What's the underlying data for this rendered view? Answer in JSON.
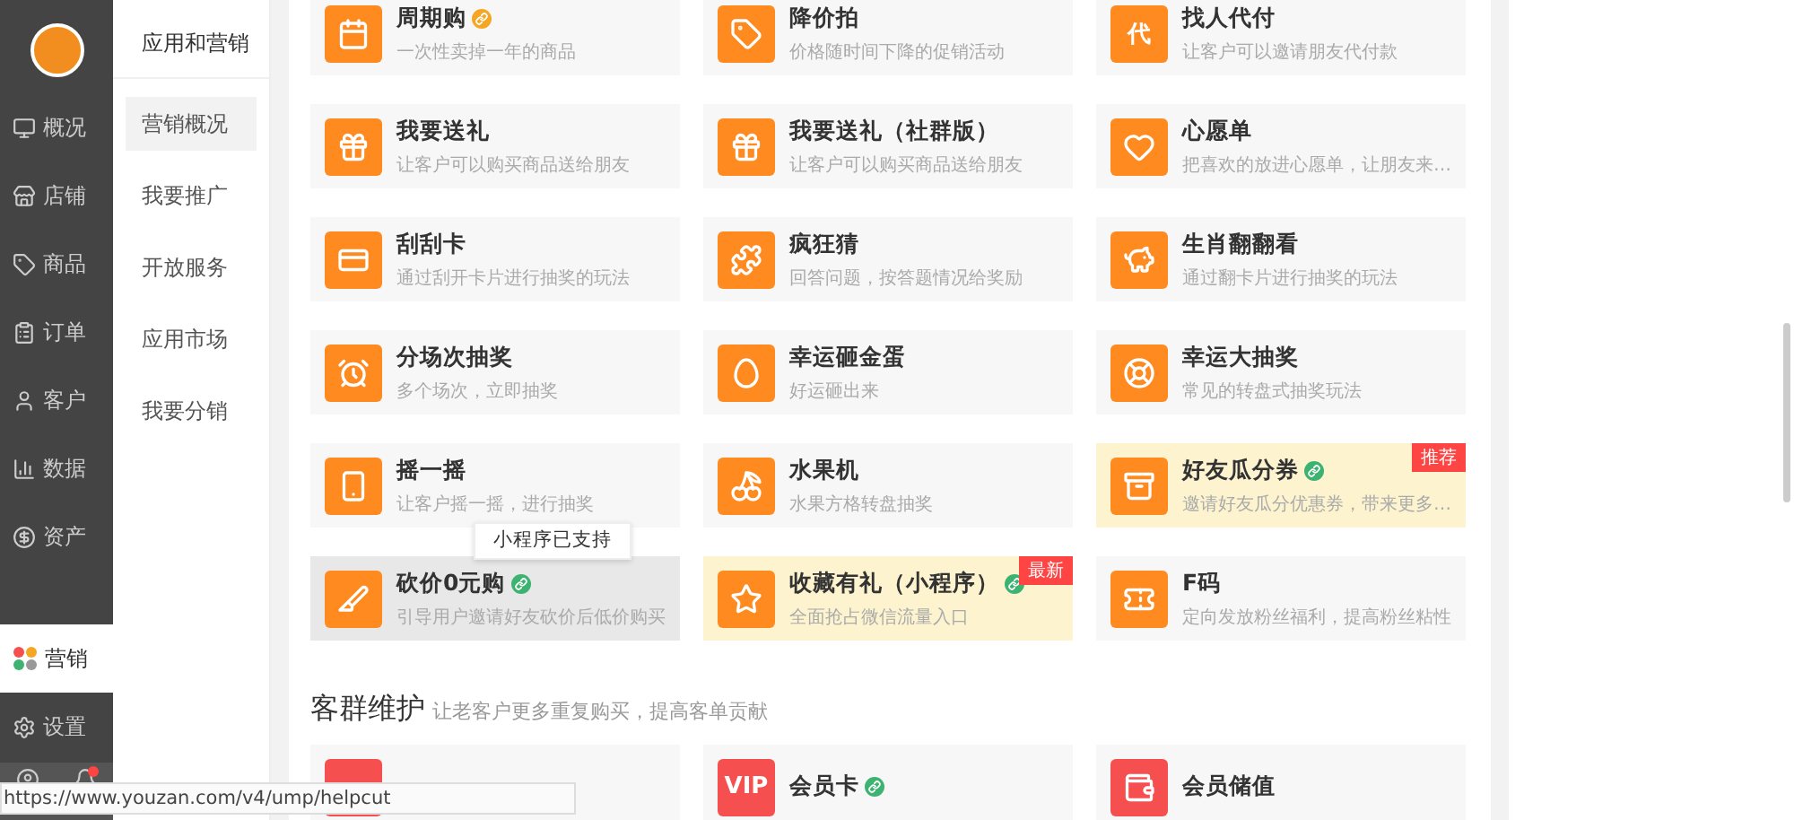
{
  "sidebar": {
    "items": [
      {
        "label": "概况",
        "kind": "monitor",
        "selected": false
      },
      {
        "label": "店铺",
        "kind": "store",
        "selected": false
      },
      {
        "label": "商品",
        "kind": "tag",
        "selected": false
      },
      {
        "label": "订单",
        "kind": "order",
        "selected": false
      },
      {
        "label": "客户",
        "kind": "user",
        "selected": false
      },
      {
        "label": "数据",
        "kind": "chart",
        "selected": false
      },
      {
        "label": "资产",
        "kind": "coin",
        "selected": false
      },
      {
        "label": "营销",
        "kind": "grid",
        "selected": true
      },
      {
        "label": "设置",
        "kind": "settings",
        "selected": false
      }
    ],
    "notification": true
  },
  "subnav": {
    "title": "应用和营销",
    "items": [
      {
        "label": "营销概况",
        "selected": true
      },
      {
        "label": "我要推广",
        "selected": false
      },
      {
        "label": "开放服务",
        "selected": false
      },
      {
        "label": "应用市场",
        "selected": false
      },
      {
        "label": "我要分销",
        "selected": false
      }
    ]
  },
  "sections": [
    {
      "cards": [
        {
          "title": "周期购",
          "desc": "一次性卖掉一年的商品",
          "kind": "calendar",
          "color": "#ff8a1f",
          "badge": {
            "color": "#f5a623"
          },
          "featured": false,
          "hovered": false
        },
        {
          "title": "降价拍",
          "desc": "价格随时间下降的促销活动",
          "kind": "tag",
          "color": "#ff8a1f",
          "featured": false,
          "hovered": false
        },
        {
          "title": "找人代付",
          "desc": "让客户可以邀请朋友代付款",
          "kind": "glyph",
          "icon_text": "代",
          "color": "#ff8a1f",
          "featured": false,
          "hovered": false
        },
        {
          "title": "我要送礼",
          "desc": "让客户可以购买商品送给朋友",
          "kind": "gift",
          "color": "#ff8a1f",
          "featured": false,
          "hovered": false
        },
        {
          "title": "我要送礼（社群版）",
          "desc": "让客户可以购买商品送给朋友",
          "kind": "gift",
          "color": "#ff8a1f",
          "featured": false,
          "hovered": false
        },
        {
          "title": "心愿单",
          "desc": "把喜欢的放进心愿单，让朋友来…",
          "kind": "heart",
          "color": "#ff8a1f",
          "featured": false,
          "hovered": false
        },
        {
          "title": "刮刮卡",
          "desc": "通过刮开卡片进行抽奖的玩法",
          "kind": "card",
          "color": "#ff8a1f",
          "featured": false,
          "hovered": false
        },
        {
          "title": "疯狂猜",
          "desc": "回答问题，按答题情况给奖励",
          "kind": "puzzle",
          "color": "#ff8a1f",
          "featured": false,
          "hovered": false
        },
        {
          "title": "生肖翻翻看",
          "desc": "通过翻卡片进行抽奖的玩法",
          "kind": "pig",
          "color": "#ff8a1f",
          "featured": false,
          "hovered": false
        },
        {
          "title": "分场次抽奖",
          "desc": "多个场次，立即抽奖",
          "kind": "alarm",
          "color": "#ff8a1f",
          "featured": false,
          "hovered": false
        },
        {
          "title": "幸运砸金蛋",
          "desc": "好运砸出来",
          "kind": "egg",
          "color": "#ff8a1f",
          "featured": false,
          "hovered": false
        },
        {
          "title": "幸运大抽奖",
          "desc": "常见的转盘式抽奖玩法",
          "kind": "wheel",
          "color": "#ff8a1f",
          "featured": false,
          "hovered": false
        },
        {
          "title": "摇一摇",
          "desc": "让客户摇一摇，进行抽奖",
          "kind": "phone",
          "color": "#ff8a1f",
          "featured": false,
          "hovered": false
        },
        {
          "title": "水果机",
          "desc": "水果方格转盘抽奖",
          "kind": "cherry",
          "color": "#ff8a1f",
          "featured": false,
          "hovered": false
        },
        {
          "title": "好友瓜分券",
          "desc": "邀请好友瓜分优惠券，带来更多…",
          "kind": "box",
          "color": "#ff8a1f",
          "badge": {
            "color": "#3cb371"
          },
          "featured": true,
          "tag": "推荐",
          "hovered": false
        },
        {
          "title": "砍价0元购",
          "desc": "引导用户邀请好友砍价后低价购买",
          "kind": "knife",
          "color": "#ff8a1f",
          "badge": {
            "color": "#3cb371"
          },
          "featured": false,
          "hovered": true,
          "tooltip": "小程序已支持"
        },
        {
          "title": "收藏有礼（小程序）",
          "desc": "全面抢占微信流量入口",
          "kind": "star",
          "color": "#ff8a1f",
          "badge": {
            "color": "#3cb371"
          },
          "featured": true,
          "tag": "最新",
          "hovered": false
        },
        {
          "title": "F码",
          "desc": "定向发放粉丝福利，提高粉丝粘性",
          "kind": "ticket",
          "color": "#ff8a1f",
          "featured": false,
          "hovered": false
        }
      ]
    },
    {
      "title": "客群维护",
      "subtitle": "让老客户更多重复购买，提高客单贡献",
      "cards": [
        {
          "kind": "blank",
          "color": "#f5504f",
          "featured": false,
          "hovered": false
        },
        {
          "title": "会员卡",
          "kind": "glyph",
          "icon_text": "VIP",
          "color": "#f5504f",
          "badge": {
            "color": "#3cb371"
          },
          "featured": false,
          "hovered": false
        },
        {
          "title": "会员储值",
          "kind": "wallet",
          "color": "#f5504f",
          "featured": false,
          "hovered": false
        }
      ]
    }
  ],
  "status_bar": {
    "url": "https://www.youzan.com/v4/ump/helpcut"
  }
}
